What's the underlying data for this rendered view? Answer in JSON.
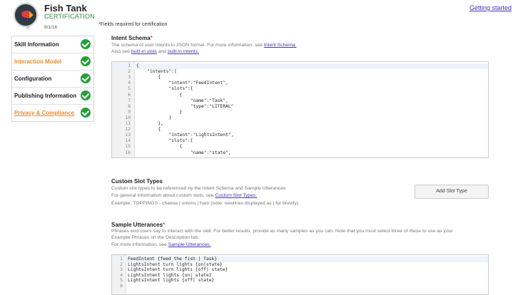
{
  "header": {
    "app_title": "Fish Tank",
    "app_subtitle": "CERTIFICATION",
    "date": "8/1/16",
    "required_star": "*",
    "required_note": "Fields required for certification",
    "getting_started": "Getting started"
  },
  "sidebar": {
    "items": [
      {
        "label": "Skill Information",
        "style": "normal"
      },
      {
        "label": "Interaction Model",
        "style": "active"
      },
      {
        "label": "Configuration",
        "style": "normal"
      },
      {
        "label": "Publishing Information",
        "style": "normal"
      },
      {
        "label": "Privacy & Compliance",
        "style": "orange-link"
      }
    ]
  },
  "intent_schema": {
    "title": "Intent Schema",
    "star": "*",
    "desc1_prefix": "The schema of user intents in JSON format. For more information, see ",
    "desc1_link": "Intent Schema.",
    "desc2_prefix": "Also see ",
    "desc2_link1": "built-in slots",
    "desc2_mid": " and ",
    "desc2_link2": "built-in intents.",
    "lines": [
      "{",
      "    \"intents\":[",
      "        {",
      "            \"intent\":\"FeedIntent\",",
      "            \"slots\":[",
      "                {",
      "                    \"name\":\"Task\",",
      "                    \"type\":\"LITERAL\"",
      "                }",
      "            ]",
      "        },",
      "        {",
      "            \"intent\":\"LightsIntent\",",
      "            \"slots\":[",
      "                {",
      "                    \"name\":\"state\","
    ]
  },
  "custom_slots": {
    "title": "Custom Slot Types",
    "desc1": "Custom slot types to be referenced by the Intent Schema and Sample Utterances",
    "desc2_prefix": "For general information about custom slots, see ",
    "desc2_link": "Custom Slot Types.",
    "desc3": "Example: TOPPINGS - cheese | onions | ham (note: newlines displayed as | for brevity)",
    "add_button": "Add Slot Type"
  },
  "sample_utterances": {
    "title": "Sample Utterances",
    "star": "*",
    "desc1": "Phrases end users say to interact with the skill. For better results, provide as many samples as you can. Note that you must select three of these to use as your",
    "desc2": "Example Phrases on the Description tab.",
    "desc3_prefix": "For more information, see ",
    "desc3_link": "Sample Utterances.",
    "lines": [
      "FeedIntent {feed the fish | Task}",
      "LightsIntent turn lights {on|state}",
      "LightsIntent turn lights {off| state}",
      "LightsIntent lights {on| state}",
      "LightsIntent lights {off| state}",
      ""
    ]
  }
}
